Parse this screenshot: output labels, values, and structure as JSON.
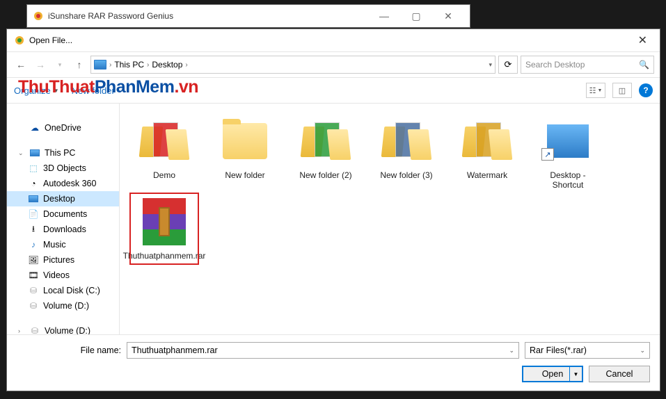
{
  "parentWindow": {
    "title": "iSunshare RAR Password Genius"
  },
  "dialog": {
    "title": "Open File...",
    "breadcrumb": {
      "pc": "This PC",
      "folder": "Desktop"
    },
    "search": {
      "placeholder": "Search Desktop"
    },
    "toolbar": {
      "organize": "Organize",
      "newFolder": "New folder"
    },
    "help": "?"
  },
  "watermark": {
    "part1": "ThuThuat",
    "part2": "PhanMem",
    "part3": ".vn"
  },
  "sidebar": {
    "onedrive": "OneDrive",
    "thispc": "This PC",
    "items": [
      {
        "label": "3D Objects"
      },
      {
        "label": "Autodesk 360"
      },
      {
        "label": "Desktop"
      },
      {
        "label": "Documents"
      },
      {
        "label": "Downloads"
      },
      {
        "label": "Music"
      },
      {
        "label": "Pictures"
      },
      {
        "label": "Videos"
      },
      {
        "label": "Local Disk (C:)"
      },
      {
        "label": "Volume (D:)"
      }
    ],
    "volume2": "Volume (D:)"
  },
  "files": [
    {
      "name": "Demo",
      "type": "folder-open",
      "accent": "#d82222"
    },
    {
      "name": "New folder",
      "type": "folder"
    },
    {
      "name": "New folder (2)",
      "type": "folder-open",
      "accent": "#2a9c3a"
    },
    {
      "name": "New folder (3)",
      "type": "folder-open",
      "accent": "#4a6fa0"
    },
    {
      "name": "Watermark",
      "type": "folder-open",
      "accent": "#d8a020"
    },
    {
      "name": "Desktop - Shortcut",
      "type": "shortcut"
    },
    {
      "name": "Thuthuatphanmem.rar",
      "type": "rar",
      "selected": true
    }
  ],
  "bottom": {
    "filenameLabel": "File name:",
    "filenameValue": "Thuthuatphanmem.rar",
    "filter": "Rar Files(*.rar)",
    "open": "Open",
    "cancel": "Cancel"
  }
}
